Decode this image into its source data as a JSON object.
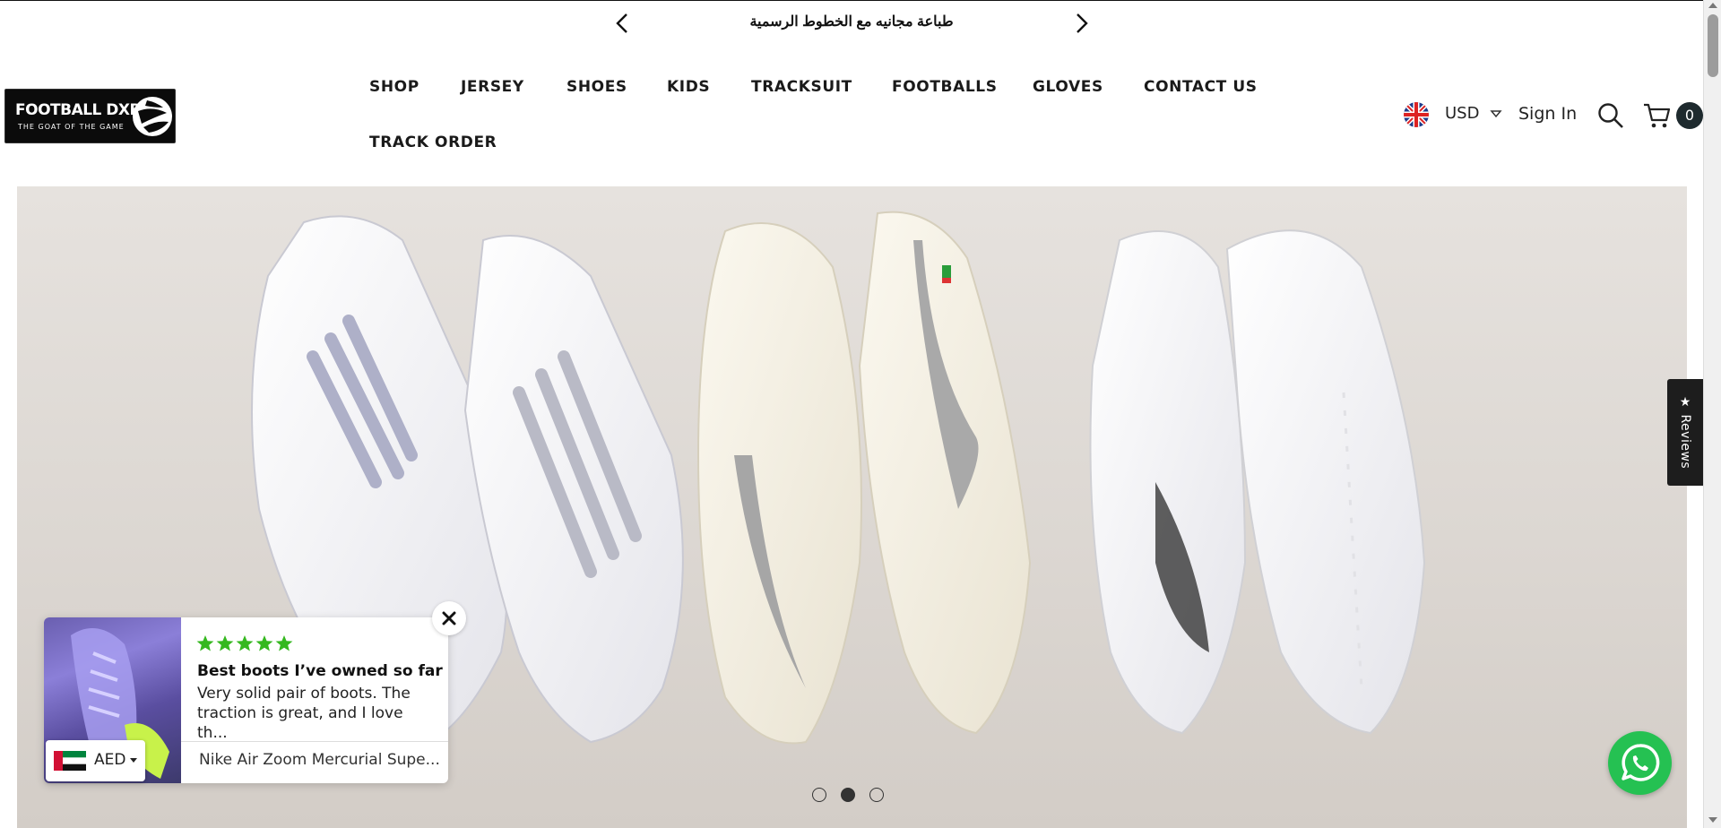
{
  "announcement": {
    "text": "طباعة مجانيه مع الخطوط الرسمية"
  },
  "logo": {
    "title": "FOOTBALL DXB",
    "tagline": "THE GOAT OF THE GAME"
  },
  "nav": {
    "items": [
      "SHOP",
      "JERSEY",
      "SHOES",
      "KIDS",
      "TRACKSUIT",
      "FOOTBALLS",
      "GLOVES",
      "CONTACT US",
      "TRACK ORDER"
    ]
  },
  "header": {
    "currency": "USD",
    "sign_in": "Sign In",
    "cart_count": "0"
  },
  "slider": {
    "slide_count": 3,
    "active_index": 1
  },
  "reviews_tab": {
    "label": "★ Reviews"
  },
  "review_popup": {
    "rating": 5,
    "title": "Best boots I’ve owned so far",
    "body": "Very solid pair of boots. The traction is great, and I love th...",
    "product": "Nike Air Zoom Mercurial Supe..."
  },
  "currency_selector": {
    "value": "AED"
  },
  "colors": {
    "star_green": "#35b81f",
    "whatsapp_green": "#25c152",
    "cart_badge": "#1e2a2e"
  }
}
